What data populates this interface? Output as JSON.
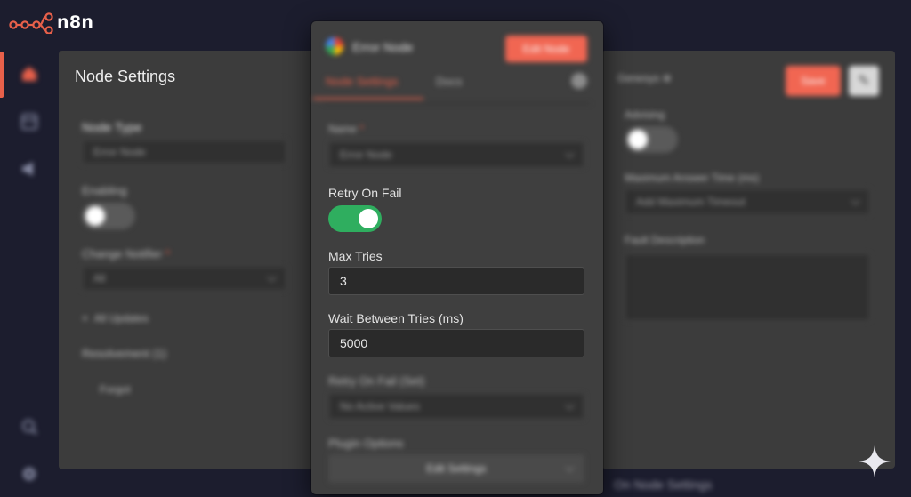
{
  "app": {
    "logo_text": "n8n"
  },
  "colors": {
    "accent": "#e8604a",
    "toggle_on": "#2fae5f",
    "background": "#1c1d2e",
    "panel": "#3f3f3f"
  },
  "rail": {
    "items": [
      {
        "icon": "home-icon"
      },
      {
        "icon": "templates-icon"
      },
      {
        "icon": "announcement-icon"
      },
      {
        "icon": "help-icon"
      },
      {
        "icon": "settings-icon"
      }
    ]
  },
  "left_panel": {
    "title": "Node Settings",
    "node_type_label": "Node Type",
    "node_type_value": "Error Node",
    "enabled_label": "Enabling",
    "enabled_on": false,
    "change_notifier_label": "Change Notifier",
    "change_notifier_value": "All",
    "all_updates_label": "All Updates",
    "resolvement_label": "Resolvement (1)",
    "forgot_label": "Forgot"
  },
  "center_panel": {
    "node_title": "Error Node",
    "header_button": "Edit Node",
    "tabs": [
      "Node Settings",
      "Docs"
    ],
    "active_tab": 0,
    "name_label": "Name",
    "name_value": "Error Node",
    "retry_on_fail_label": "Retry On Fail",
    "retry_on_fail_on": true,
    "max_tries_label": "Max Tries",
    "max_tries_value": "3",
    "wait_between_tries_label": "Wait Between Tries (ms)",
    "wait_between_tries_value": "5000",
    "retry_on_fail_select_label": "Retry On Fail (Set)",
    "retry_on_fail_select_value": "No Active Values",
    "plugin_options_label": "Plugin Options",
    "edit_settings_button": "Edit Settings"
  },
  "right_panel": {
    "header_label": "Genesys",
    "save_button": "Save",
    "advising_label": "Advising",
    "advising_on": false,
    "max_timeout_label": "Maximum Answer Time (ms)",
    "max_timeout_placeholder": "Add Maximum Timeout",
    "fault_description_label": "Fault Description",
    "footer_link": "On Node Settings"
  }
}
